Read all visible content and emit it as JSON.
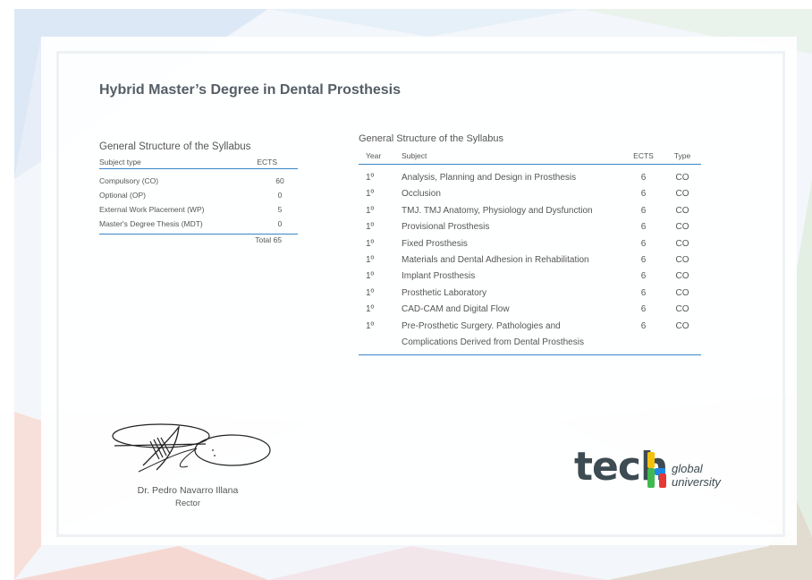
{
  "title": "Hybrid Master’s Degree in Dental Prosthesis",
  "summary": {
    "heading": "General Structure of the Syllabus",
    "col_subject_type": "Subject type",
    "col_ects": "ECTS",
    "rows": [
      {
        "type": "Compulsory (CO)",
        "ects": "60"
      },
      {
        "type": "Optional (OP)",
        "ects": "0"
      },
      {
        "type": "External Work Placement (WP)",
        "ects": "5"
      },
      {
        "type": "Master's Degree Thesis (MDT)",
        "ects": "0"
      }
    ],
    "total": "Total 65"
  },
  "subjects": {
    "heading": "General Structure of the Syllabus",
    "columns": {
      "year": "Year",
      "subject": "Subject",
      "ects": "ECTS",
      "type": "Type"
    },
    "rows": [
      {
        "year": "1º",
        "subject": "Analysis, Planning and Design in Prosthesis",
        "subject2": "",
        "ects": "6",
        "type": "CO"
      },
      {
        "year": "1º",
        "subject": "Occlusion",
        "subject2": "",
        "ects": "6",
        "type": "CO"
      },
      {
        "year": "1º",
        "subject": "TMJ. TMJ Anatomy, Physiology and Dysfunction",
        "subject2": "",
        "ects": "6",
        "type": "CO"
      },
      {
        "year": "1º",
        "subject": "Provisional Prosthesis",
        "subject2": "",
        "ects": "6",
        "type": "CO"
      },
      {
        "year": "1º",
        "subject": "Fixed Prosthesis",
        "subject2": "",
        "ects": "6",
        "type": "CO"
      },
      {
        "year": "1º",
        "subject": "Materials and Dental Adhesion in Rehabilitation",
        "subject2": "",
        "ects": "6",
        "type": "CO"
      },
      {
        "year": "1º",
        "subject": "Implant Prosthesis",
        "subject2": "",
        "ects": "6",
        "type": "CO"
      },
      {
        "year": "1º",
        "subject": "Prosthetic Laboratory",
        "subject2": "",
        "ects": "6",
        "type": "CO"
      },
      {
        "year": "1º",
        "subject": "CAD-CAM and Digital Flow",
        "subject2": "",
        "ects": "6",
        "type": "CO"
      },
      {
        "year": "1º",
        "subject": "Pre-Prosthetic Surgery. Pathologies and",
        "subject2": "Complications Derived from Dental Prosthesis",
        "ects": "6",
        "type": "CO"
      }
    ]
  },
  "signature": {
    "name": "Dr. Pedro Navarro Illana",
    "role": "Rector"
  },
  "logo": {
    "word": "tech",
    "line1": "global",
    "line2": "university",
    "accent_colors": [
      "#f4c20d",
      "#3fb950",
      "#1e88e5",
      "#e53935"
    ]
  }
}
